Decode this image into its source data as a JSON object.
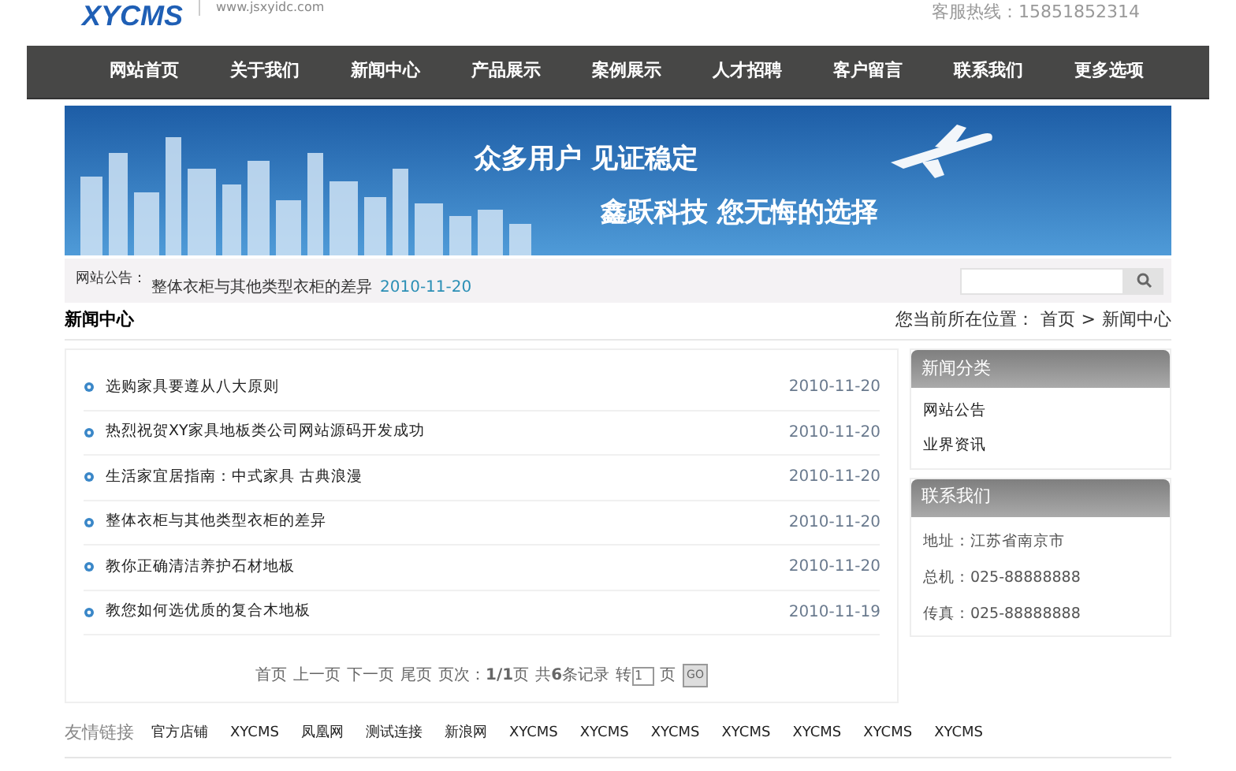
{
  "header": {
    "logo": "XYCMS",
    "site_url": "www.jsxyidc.com",
    "hotline": "客服热线：15851852314"
  },
  "nav": [
    {
      "label": "网站首页"
    },
    {
      "label": "关于我们"
    },
    {
      "label": "新闻中心"
    },
    {
      "label": "产品展示"
    },
    {
      "label": "案例展示"
    },
    {
      "label": "人才招聘"
    },
    {
      "label": "客户留言"
    },
    {
      "label": "联系我们"
    },
    {
      "label": "更多选项"
    }
  ],
  "banner": {
    "line_1": "众多用户  见证稳定",
    "line_2": "鑫跃科技  您无悔的选择"
  },
  "notice": {
    "label": "网站公告：",
    "title": "整体衣柜与其他类型衣柜的差异",
    "date": "2010-11-20"
  },
  "section_title": "新闻中心",
  "breadcrumb": {
    "prefix": "您当前所在位置：",
    "items": [
      "首页",
      ">",
      "新闻中心"
    ]
  },
  "news": [
    {
      "title": "选购家具要遵从八大原则",
      "date": "2010-11-20"
    },
    {
      "title": "热烈祝贺XY家具地板类公司网站源码开发成功",
      "date": "2010-11-20"
    },
    {
      "title": "生活家宜居指南：中式家具  古典浪漫",
      "date": "2010-11-20"
    },
    {
      "title": "整体衣柜与其他类型衣柜的差异",
      "date": "2010-11-20"
    },
    {
      "title": "教你正确清洁养护石材地板",
      "date": "2010-11-20"
    },
    {
      "title": "教您如何选优质的复合木地板",
      "date": "2010-11-19"
    }
  ],
  "pager": {
    "links": [
      "首页",
      "上一页",
      "下一页",
      "尾页"
    ],
    "page_info": "页次：**1/1**页",
    "total": "共**6**条记录",
    "goto_prefix": "转",
    "goto_value": "1",
    "goto_suffix": "页",
    "go_button": "GO"
  },
  "sidebar": [
    {
      "title": "新闻分类",
      "items": [
        {
          "text": "网站公告",
          "kind": "link"
        },
        {
          "text": "业界资讯",
          "kind": "link"
        }
      ]
    },
    {
      "title": "联系我们",
      "items": [
        {
          "text": "地址：江苏省南京市",
          "kind": "text"
        },
        {
          "text": "总机：025-88888888",
          "kind": "text"
        },
        {
          "text": "传真：025-88888888",
          "kind": "text"
        }
      ]
    }
  ],
  "friend_links": {
    "label": "友情链接",
    "items": [
      "官方店铺",
      "XYCMS",
      "凤凰网",
      "测试连接",
      "新浪网",
      "XYCMS",
      "XYCMS",
      "XYCMS",
      "XYCMS",
      "XYCMS",
      "XYCMS",
      "XYCMS"
    ]
  }
}
